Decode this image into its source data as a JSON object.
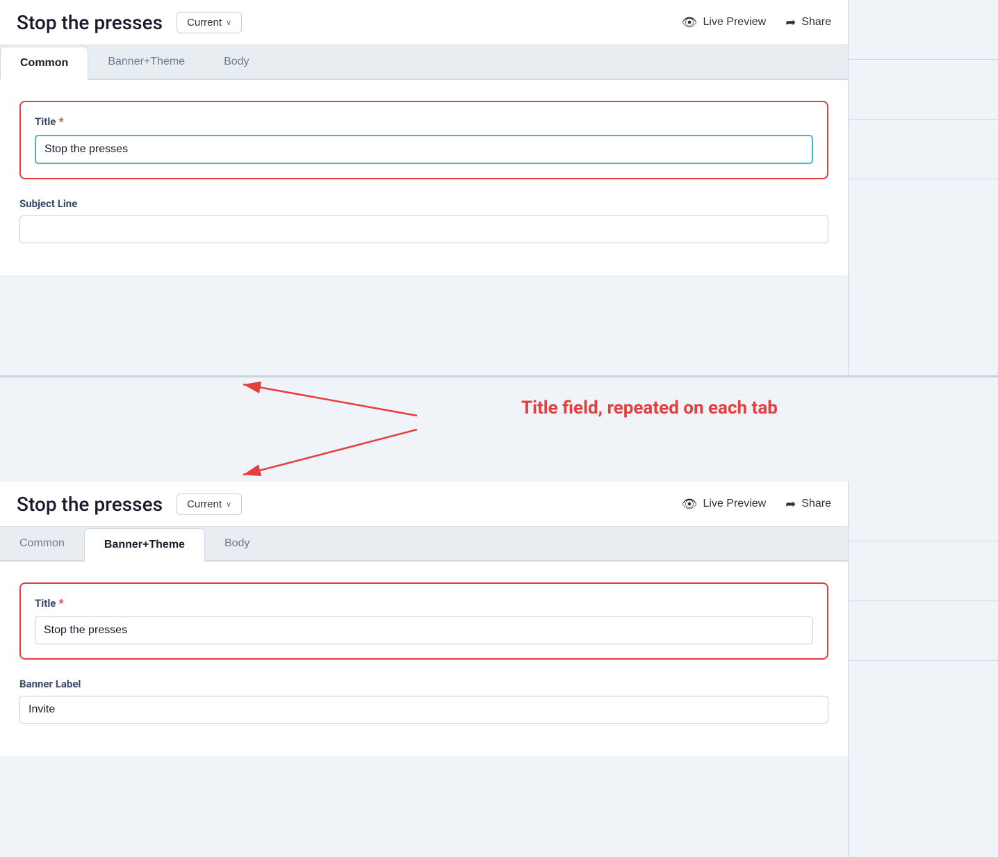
{
  "top": {
    "header": {
      "title": "Stop the presses",
      "version_label": "Current",
      "live_preview_label": "Live Preview",
      "share_label": "Share"
    },
    "tabs": [
      {
        "id": "common",
        "label": "Common",
        "active": true
      },
      {
        "id": "banner-theme",
        "label": "Banner+Theme",
        "active": false
      },
      {
        "id": "body",
        "label": "Body",
        "active": false
      }
    ],
    "form": {
      "title_label": "Title",
      "title_required": true,
      "title_value": "Stop the presses",
      "subject_label": "Subject Line",
      "subject_value": ""
    }
  },
  "annotation": {
    "text": "Title field, repeated on each tab"
  },
  "bottom": {
    "header": {
      "title": "Stop the presses",
      "version_label": "Current",
      "live_preview_label": "Live Preview",
      "share_label": "Share"
    },
    "tabs": [
      {
        "id": "common",
        "label": "Common",
        "active": false
      },
      {
        "id": "banner-theme",
        "label": "Banner+Theme",
        "active": true
      },
      {
        "id": "body",
        "label": "Body",
        "active": false
      }
    ],
    "form": {
      "title_label": "Title",
      "title_required": true,
      "title_value": "Stop the presses",
      "banner_label": "Banner Label",
      "banner_value": "Invite"
    }
  },
  "icons": {
    "eye": "👁",
    "share": "➦",
    "chevron": "∨"
  }
}
